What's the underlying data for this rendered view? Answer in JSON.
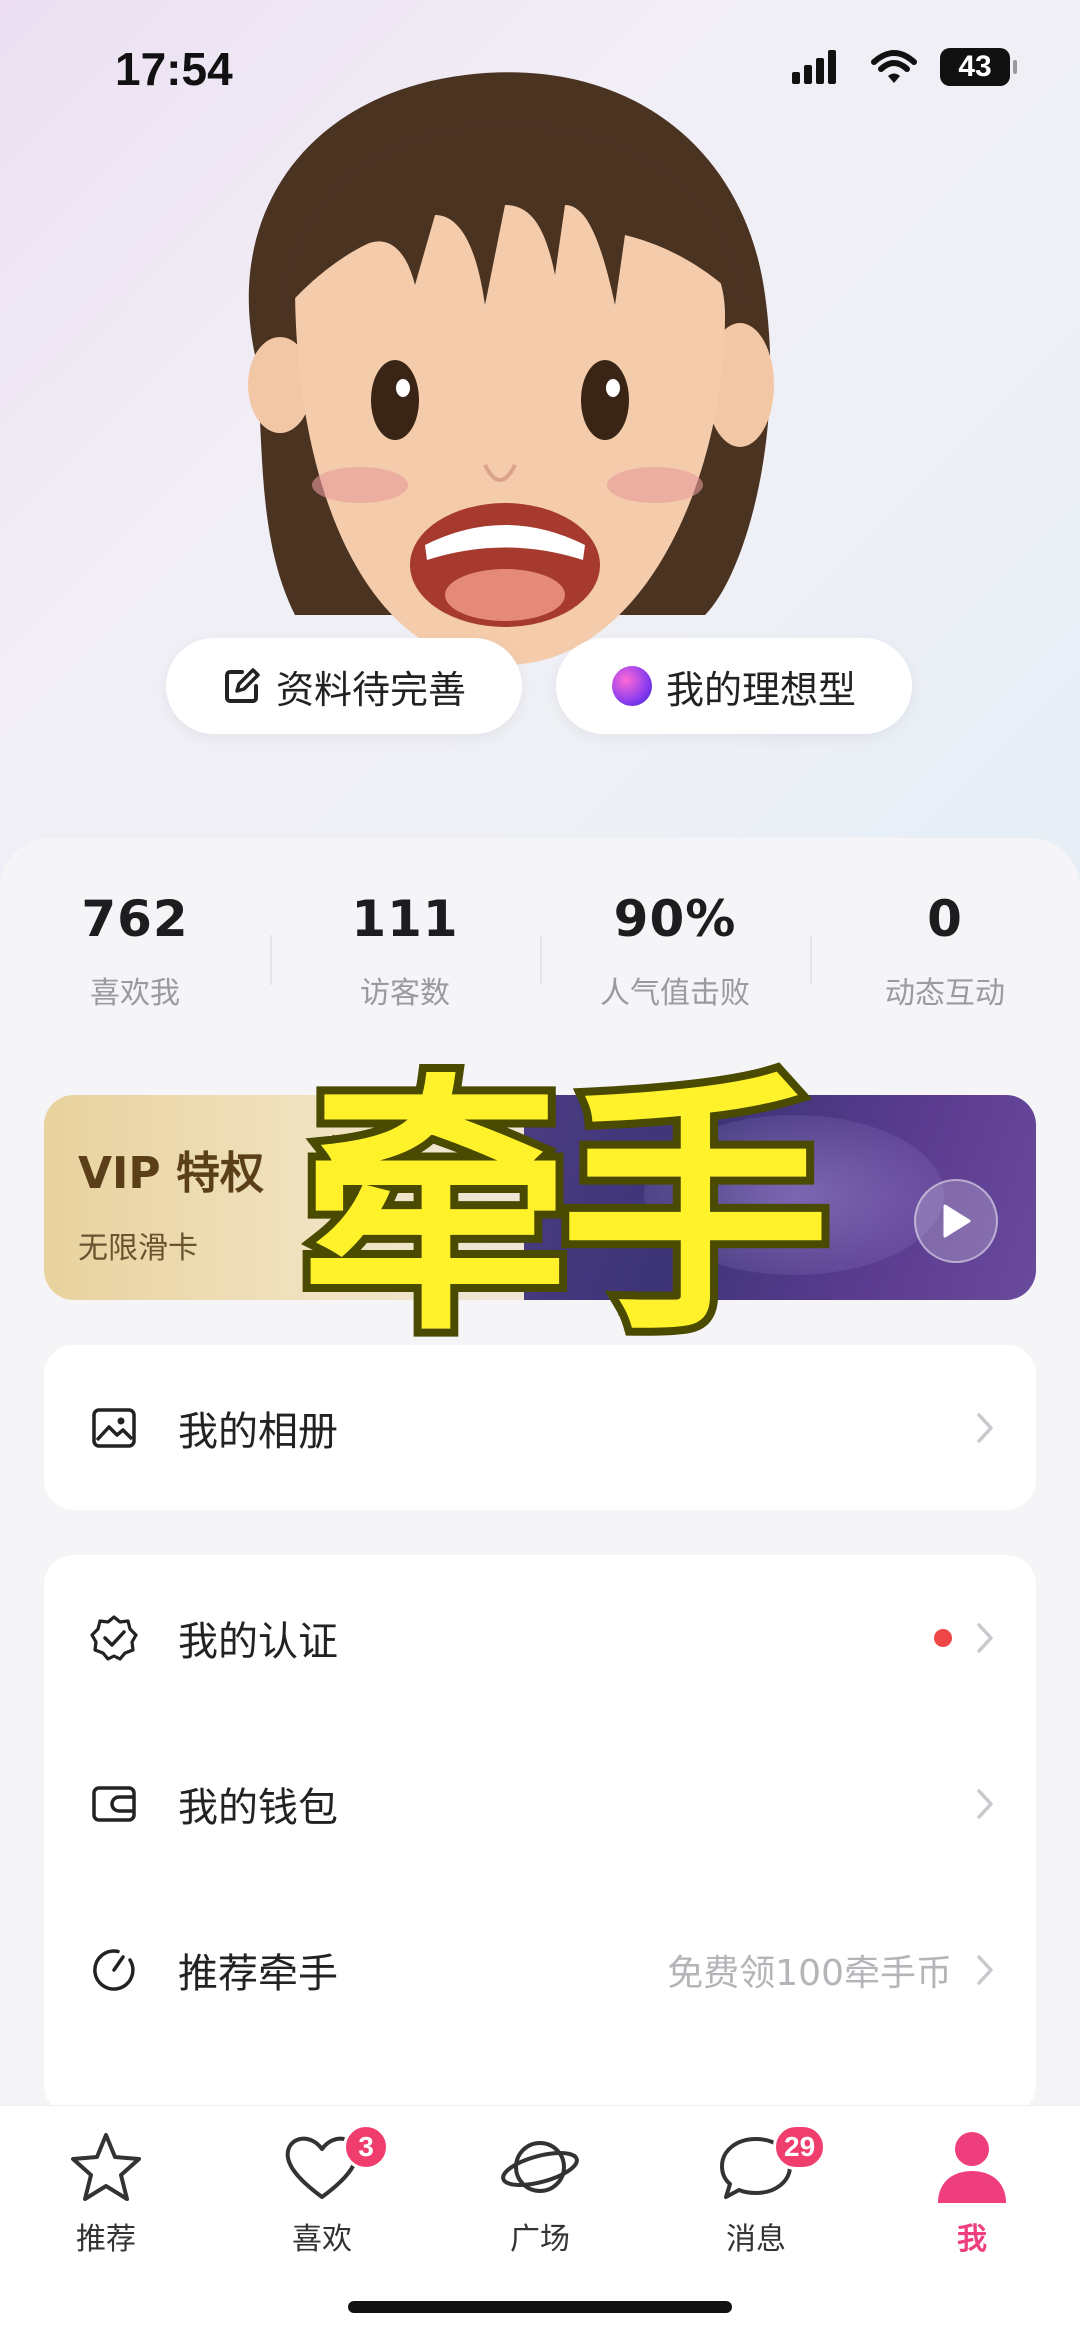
{
  "status_bar": {
    "time": "17:54",
    "battery": "43"
  },
  "profile": {
    "complete_profile_label": "资料待完善",
    "ideal_type_label": "我的理想型"
  },
  "stats": [
    {
      "value": "762",
      "label": "喜欢我"
    },
    {
      "value": "111",
      "label": "访客数"
    },
    {
      "value": "90%",
      "label": "人气值击败"
    },
    {
      "value": "0",
      "label": "动态互动"
    }
  ],
  "vip": {
    "title": "VIP 特权",
    "subtitle": "无限滑卡"
  },
  "overlay": {
    "text": "牵手"
  },
  "menu": {
    "album": {
      "label": "我的相册"
    },
    "verify": {
      "label": "我的认证"
    },
    "wallet": {
      "label": "我的钱包"
    },
    "recommend": {
      "label": "推荐牵手",
      "hint": "免费领100牵手币"
    }
  },
  "tabs": [
    {
      "label": "推荐",
      "icon": "star-icon"
    },
    {
      "label": "喜欢",
      "icon": "heart-icon",
      "badge": "3"
    },
    {
      "label": "广场",
      "icon": "planet-icon"
    },
    {
      "label": "消息",
      "icon": "chat-bubble-icon",
      "badge": "29"
    },
    {
      "label": "我",
      "icon": "person-icon",
      "active": true
    }
  ],
  "colors": {
    "accent": "#ef3e7d",
    "badge": "#ef3e6d",
    "red_dot": "#ef4747",
    "overlay_text": "#fff22a"
  }
}
